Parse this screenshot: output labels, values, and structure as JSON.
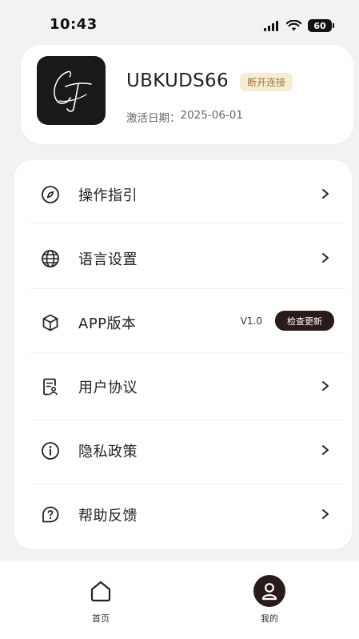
{
  "status_bar": {
    "time": "10:43",
    "battery": "60"
  },
  "profile": {
    "device_name": "UBKUDS66",
    "connection_status": "断开连接",
    "activation_label": "激活日期：",
    "activation_date": "2025-06-01",
    "avatar_icon": "brand-logo",
    "badge_color": "#f6ecd6"
  },
  "menu": {
    "items": [
      {
        "label": "操作指引",
        "icon": "compass-icon"
      },
      {
        "label": "语言设置",
        "icon": "globe-icon"
      },
      {
        "label": "APP版本",
        "icon": "cube-icon",
        "value": "V1.0",
        "action": "检查更新"
      },
      {
        "label": "用户协议",
        "icon": "document-user-icon"
      },
      {
        "label": "隐私政策",
        "icon": "info-icon"
      },
      {
        "label": "帮助反馈",
        "icon": "help-icon"
      }
    ]
  },
  "bottom_nav": {
    "home_label": "首页",
    "mine_label": "我的",
    "active": "mine",
    "accent": "#2a1b1b"
  }
}
